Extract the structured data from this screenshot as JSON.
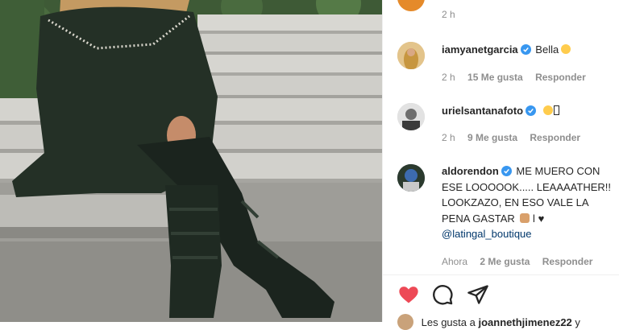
{
  "post": {
    "image_alt": "woman in green leather outfit and boots sitting on stone steps"
  },
  "comments": [
    {
      "avatar": "avatar-photo-orange",
      "username": "",
      "text": "",
      "time": "2 h",
      "likes": "",
      "reply": ""
    },
    {
      "avatar": "avatar-photo-blonde",
      "username": "iamyanetgarcia",
      "text": "Bella",
      "time": "2 h",
      "likes": "15 Me gusta",
      "reply": "Responder"
    },
    {
      "avatar": "avatar-photo-man",
      "username": "urielsantanafoto",
      "text": "",
      "time": "2 h",
      "likes": "9 Me gusta",
      "reply": "Responder"
    },
    {
      "avatar": "avatar-photo-aldo",
      "username": "aldorendon",
      "text": "ME MUERO CON ESE LOOOOOK..... LEAAAATHER!! LOOKZAZO, EN ESO VALE LA PENA GASTAR",
      "text_tail": "l",
      "mention": "@latingal_boutique",
      "time": "Ahora",
      "likes": "2 Me gusta",
      "reply": "Responder"
    }
  ],
  "actions": {
    "like": "heart-icon",
    "comment": "comment-icon",
    "share": "share-icon"
  },
  "liked_by": {
    "prefix": "Les gusta a",
    "user": "joannethjimenez22",
    "suffix": "y"
  },
  "colors": {
    "heart": "#ed4956",
    "verified": "#3897f0",
    "muted": "#8e8e8e",
    "mention": "#00376b"
  }
}
